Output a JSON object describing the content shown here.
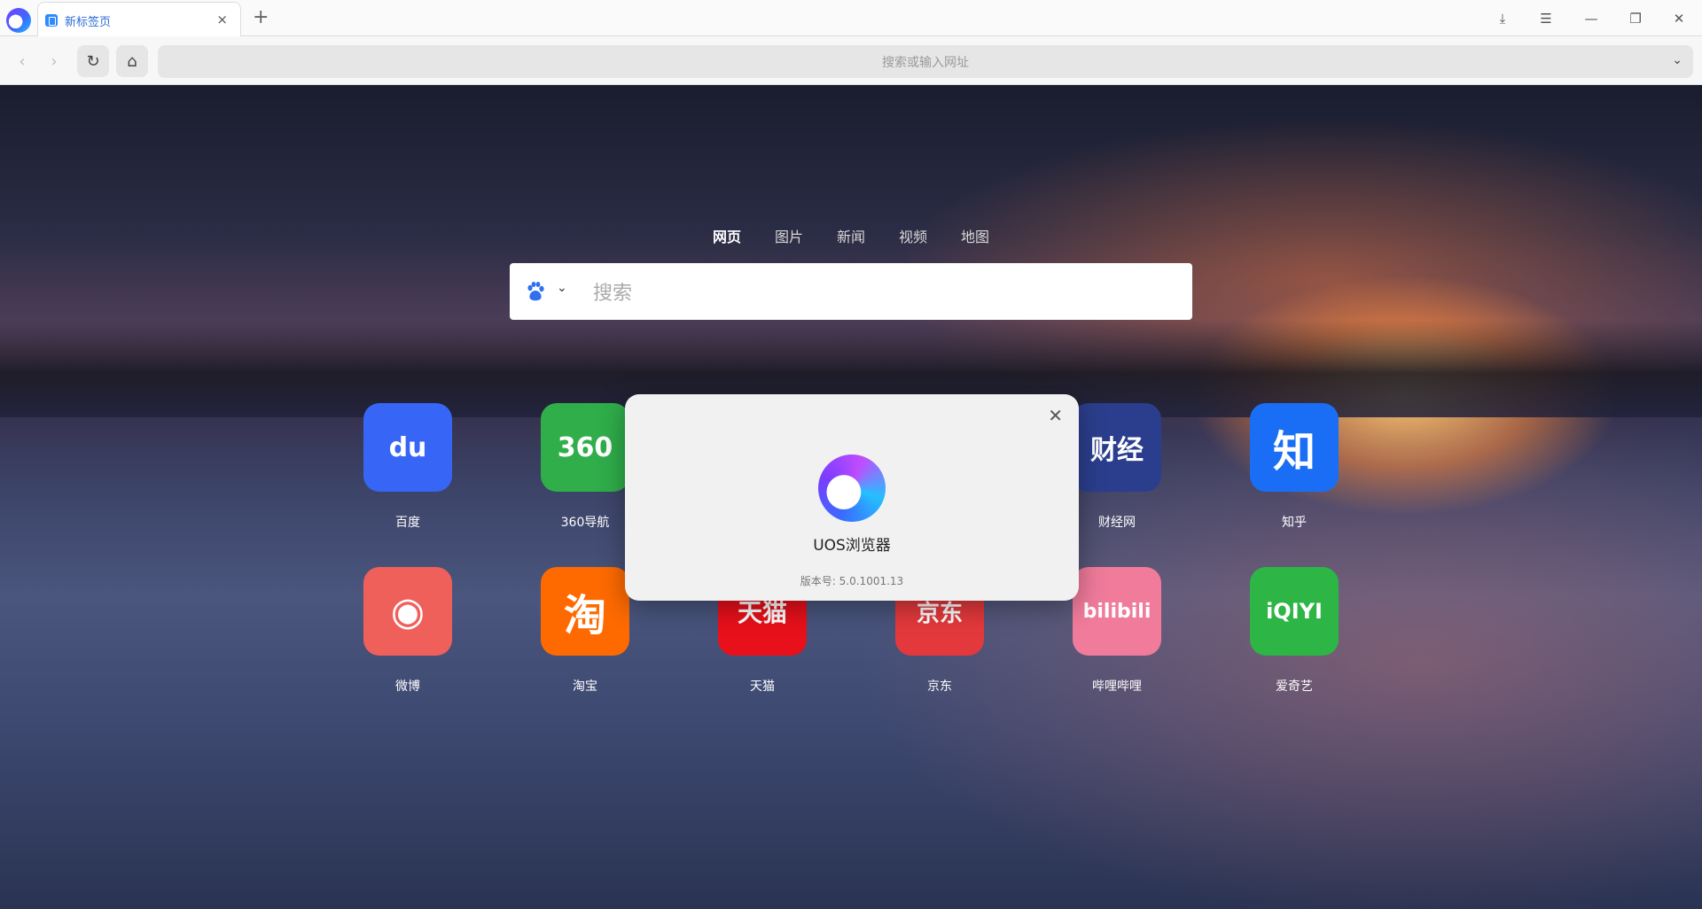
{
  "tab": {
    "title": "新标签页",
    "close": "×"
  },
  "titlebar": {
    "new_tab": "+",
    "download": "⤓",
    "menu": "☰",
    "minimize": "—",
    "restore": "❐",
    "close": "✕"
  },
  "toolbar": {
    "back": "‹",
    "forward": "›",
    "reload": "↻",
    "home": "⌂",
    "address_placeholder": "搜索或输入网址",
    "dropdown": "⌄"
  },
  "search": {
    "engines": [
      "网页",
      "图片",
      "新闻",
      "视频",
      "地图"
    ],
    "active_engine": "网页",
    "placeholder": "搜索",
    "chevron": "⌄"
  },
  "sites": [
    {
      "label": "百度",
      "icon_text": "du",
      "color": "#3766f6"
    },
    {
      "label": "360导航",
      "icon_text": "360",
      "color": "#2fae4a"
    },
    {
      "label": "财经网",
      "icon_text": "财经",
      "color": "#2b3e8d"
    },
    {
      "label": "知乎",
      "icon_text": "知",
      "color": "#1a6ef5"
    },
    {
      "label": "微博",
      "icon_text": "◉",
      "color": "#f0605b"
    },
    {
      "label": "淘宝",
      "icon_text": "淘",
      "color": "#ff6a00"
    },
    {
      "label": "天猫",
      "icon_text": "天猫",
      "color": "#e8101b"
    },
    {
      "label": "京东",
      "icon_text": "京东",
      "color": "#e4393c"
    },
    {
      "label": "哔哩哔哩",
      "icon_text": "bilibili",
      "color": "#f07b9b"
    },
    {
      "label": "爱奇艺",
      "icon_text": "iQIYI",
      "color": "#2db545"
    }
  ],
  "dialog": {
    "title": "UOS浏览器",
    "version": "版本号: 5.0.1001.13",
    "close": "✕"
  }
}
